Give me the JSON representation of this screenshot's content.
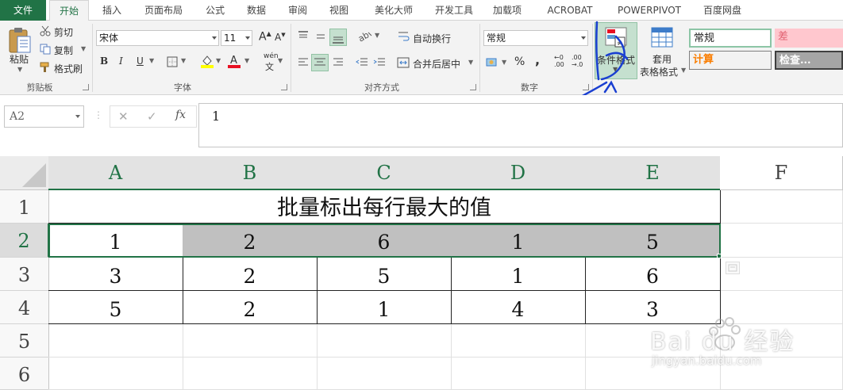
{
  "tabs": [
    "文件",
    "开始",
    "插入",
    "页面布局",
    "公式",
    "数据",
    "审阅",
    "视图",
    "美化大师",
    "开发工具",
    "加载项",
    "ACROBAT",
    "POWERPIVOT",
    "百度网盘"
  ],
  "clipboard": {
    "paste": "粘贴",
    "cut": "剪切",
    "copy": "复制",
    "format_painter": "格式刷",
    "group": "剪贴板"
  },
  "font": {
    "name": "宋体",
    "size": "11",
    "group": "字体",
    "bold": "B",
    "italic": "I",
    "underline": "U",
    "wen": "wén"
  },
  "alignment": {
    "wrap": "自动换行",
    "merge": "合并后居中",
    "group": "对齐方式"
  },
  "number": {
    "format": "常规",
    "group": "数字",
    "percent": "%",
    "comma": ","
  },
  "styles": {
    "conditional": "条件格式",
    "table_format_1": "套用",
    "table_format_2": "表格格式",
    "normal": "常规",
    "bad": "差",
    "calc": "计算",
    "check": "检查..."
  },
  "formula_bar": {
    "name_box": "A2",
    "value": "1",
    "fx": "fx"
  },
  "grid": {
    "columns": [
      "A",
      "B",
      "C",
      "D",
      "E",
      "F"
    ],
    "rows": [
      "1",
      "2",
      "3",
      "4",
      "5",
      "6"
    ],
    "title": "批量标出每行最大的值",
    "data": [
      [
        "1",
        "2",
        "6",
        "1",
        "5"
      ],
      [
        "3",
        "2",
        "5",
        "1",
        "6"
      ],
      [
        "5",
        "2",
        "1",
        "4",
        "3"
      ]
    ]
  },
  "watermark": {
    "brand": "Bai du 经验",
    "url": "jingyan.baidu.com"
  },
  "colors": {
    "accent": "#217346",
    "highlight": "#c0c0c0",
    "bad_fill": "#ffc7ce",
    "bad_text": "#9c0006",
    "calc_text": "#fa7d00"
  }
}
